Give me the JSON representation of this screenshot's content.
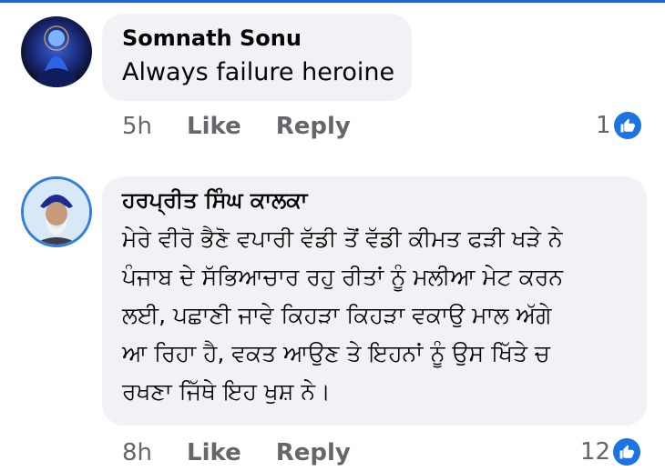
{
  "comments": [
    {
      "author": "Somnath Sonu",
      "text": "Always failure heroine",
      "time": "5h",
      "like_label": "Like",
      "reply_label": "Reply",
      "reaction_count": "1",
      "reaction_icon": "like-icon",
      "accent_color": "#1b74e4"
    },
    {
      "author": "ਹਰਪ੍ਰੀਤ ਸਿੰਘ ਕਾਲਕਾ",
      "text_lines": [
        "ਮੇਰੇ ਵੀਰੋ ਭੈਣੋ ਵਪਾਰੀ ਵੱਡੀ ਤੋਂ ਵੱਡੀ ਕੀਮਤ ਫੜੀ ਖੜੇ ਨੇ",
        "ਪੰਜਾਬ ਦੇ ਸੱਭਿਆਚਾਰ ਰਹੁ ਰੀਤਾਂ ਨੂੰ ਮਲੀਆ ਮੇਟ ਕਰਨ",
        "ਲਈ, ਪਛਾਣੀ ਜਾਵੇ ਕਿਹੜਾ ਕਿਹੜਾ ਵਕਾਉ ਮਾਲ ਅੱਗੇ",
        "ਆ ਰਿਹਾ ਹੈ, ਵਕਤ ਆਉਣ ਤੇ ਇਹਨਾਂ ਨੂੰ ਉਸ ਖਿੱਤੇ ਚ",
        "ਰਖਣਾ ਜਿੱਥੇ ਇਹ ਖੁਸ਼ ਨੇ।"
      ],
      "time": "8h",
      "like_label": "Like",
      "reply_label": "Reply",
      "reaction_count": "12",
      "reaction_icon": "like-icon"
    }
  ]
}
